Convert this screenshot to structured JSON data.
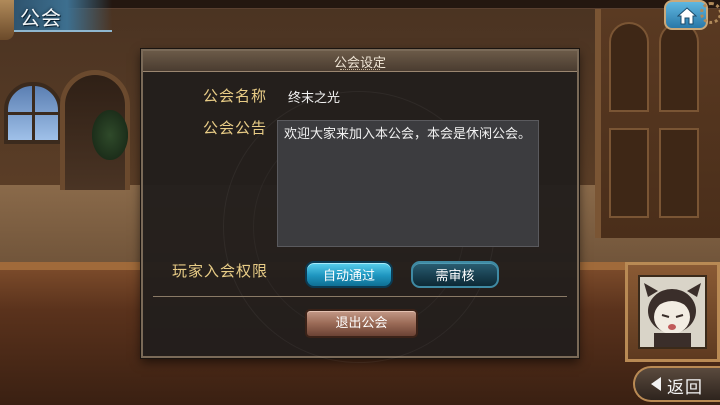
{
  "header": {
    "title": "公会"
  },
  "dialog": {
    "title": "公会设定",
    "guild_name_label": "公会名称",
    "guild_name_value": "终末之光",
    "announcement_label": "公会公告",
    "announcement_text": "欢迎大家来加入本公会，本会是休闲公会。",
    "permission_label": "玩家入会权限",
    "permission_options": [
      {
        "label": "自动通过",
        "selected": true
      },
      {
        "label": "需审核",
        "selected": false
      }
    ],
    "quit_button_label": "退出公会"
  },
  "footer": {
    "back_label": "返回"
  },
  "colors": {
    "label_gold": "#e8cc86",
    "selected_button": "#1e95bf",
    "unselected_button": "#173d4d",
    "quit_button": "#9a6a56"
  },
  "icons": {
    "home": "home-icon",
    "back": "back-arrow-icon"
  }
}
